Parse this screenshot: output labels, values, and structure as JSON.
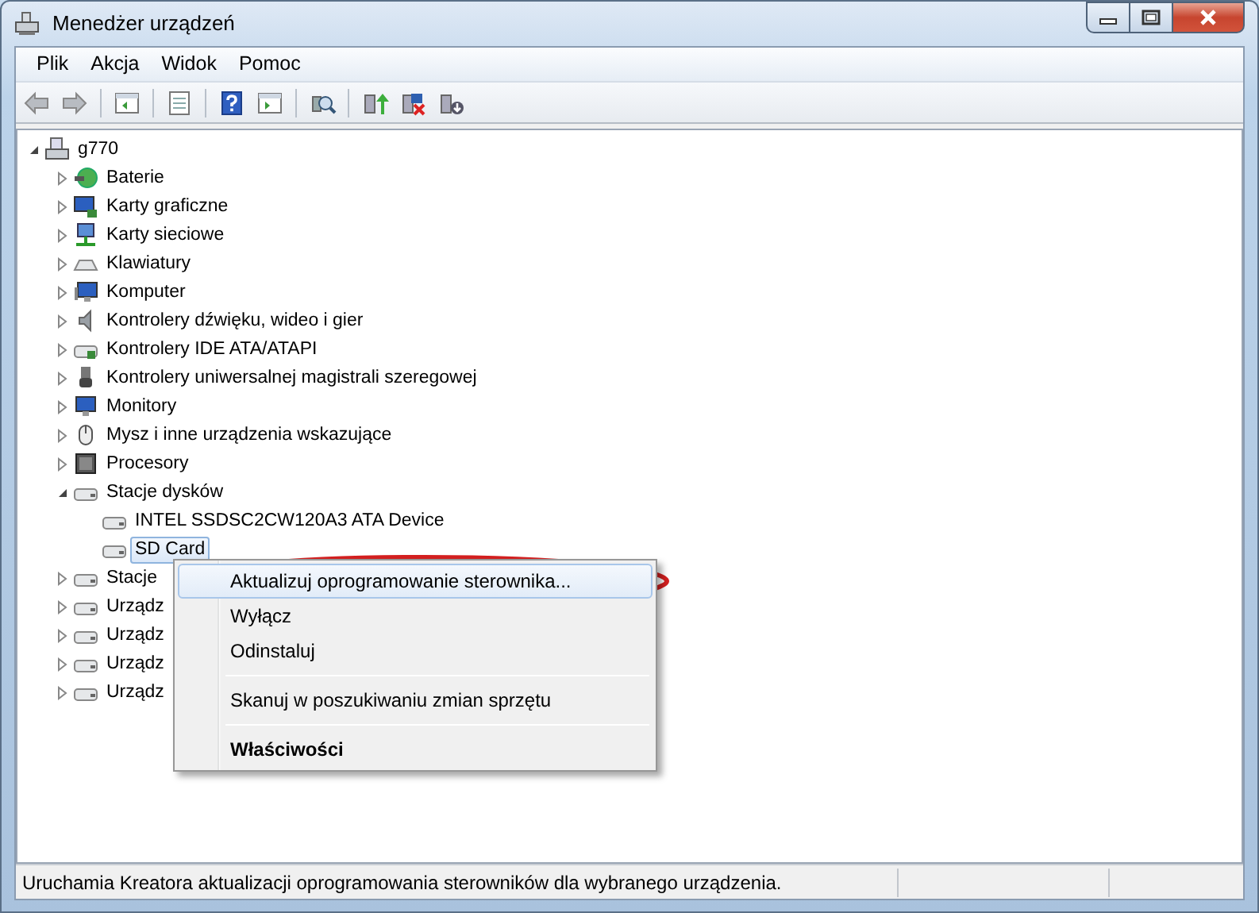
{
  "window": {
    "title": "Menedżer urządzeń"
  },
  "menu_bar": [
    "Plik",
    "Akcja",
    "Widok",
    "Pomoc"
  ],
  "tree": {
    "label": "g770",
    "expanded": true,
    "selected": false,
    "children": [
      {
        "label": "Baterie",
        "expanded": false,
        "selected": false
      },
      {
        "label": "Karty graficzne",
        "expanded": false,
        "selected": false
      },
      {
        "label": "Karty sieciowe",
        "expanded": false,
        "selected": false
      },
      {
        "label": "Klawiatury",
        "expanded": false,
        "selected": false
      },
      {
        "label": "Komputer",
        "expanded": false,
        "selected": false
      },
      {
        "label": "Kontrolery dźwięku, wideo i gier",
        "expanded": false,
        "selected": false
      },
      {
        "label": "Kontrolery IDE ATA/ATAPI",
        "expanded": false,
        "selected": false
      },
      {
        "label": "Kontrolery uniwersalnej magistrali szeregowej",
        "expanded": false,
        "selected": false
      },
      {
        "label": "Monitory",
        "expanded": false,
        "selected": false
      },
      {
        "label": "Mysz i inne urządzenia wskazujące",
        "expanded": false,
        "selected": false
      },
      {
        "label": "Procesory",
        "expanded": false,
        "selected": false
      },
      {
        "label": "Stacje dysków",
        "expanded": true,
        "selected": false,
        "children": [
          {
            "label": "INTEL SSDSC2CW120A3 ATA Device",
            "selected": false
          },
          {
            "label": "SD Card",
            "selected": true
          }
        ]
      },
      {
        "label": "Stacje",
        "expanded": false,
        "selected": false
      },
      {
        "label": "Urządz",
        "expanded": false,
        "selected": false
      },
      {
        "label": "Urządz",
        "expanded": false,
        "selected": false
      },
      {
        "label": "Urządz",
        "expanded": false,
        "selected": false
      },
      {
        "label": "Urządz",
        "expanded": false,
        "selected": false
      }
    ]
  },
  "context_menu": [
    {
      "kind": "item",
      "label": "Aktualizuj oprogramowanie sterownika...",
      "bold": false,
      "highlighted": true
    },
    {
      "kind": "item",
      "label": "Wyłącz",
      "bold": false,
      "highlighted": false
    },
    {
      "kind": "item",
      "label": "Odinstaluj",
      "bold": false,
      "highlighted": false
    },
    {
      "kind": "separator"
    },
    {
      "kind": "item",
      "label": "Skanuj w poszukiwaniu zmian sprzętu",
      "bold": false,
      "highlighted": false
    },
    {
      "kind": "separator"
    },
    {
      "kind": "item",
      "label": "Właściwości",
      "bold": true,
      "highlighted": false
    }
  ],
  "status_bar": {
    "text": "Uruchamia Kreatora aktualizacji oprogramowania sterowników dla wybranego urządzenia."
  }
}
